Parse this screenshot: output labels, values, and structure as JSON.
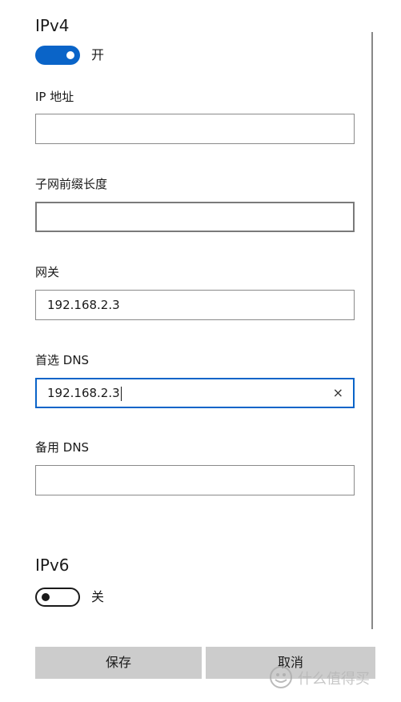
{
  "ipv4": {
    "title": "IPv4",
    "toggle_state": "开"
  },
  "fields": {
    "ip_address": {
      "label": "IP 地址",
      "value": ""
    },
    "subnet_prefix": {
      "label": "子网前缀长度",
      "value": ""
    },
    "gateway": {
      "label": "网关",
      "value": "192.168.2.3"
    },
    "preferred_dns": {
      "label": "首选 DNS",
      "value": "192.168.2.3"
    },
    "alternate_dns": {
      "label": "备用 DNS",
      "value": ""
    }
  },
  "ipv6": {
    "title": "IPv6",
    "toggle_state": "关"
  },
  "buttons": {
    "save": "保存",
    "cancel": "取消"
  },
  "clear_glyph": "×",
  "watermark": "什么值得买",
  "colors": {
    "accent": "#0a64c8",
    "button_bg": "#cccccc",
    "border": "#8a8a8a"
  }
}
